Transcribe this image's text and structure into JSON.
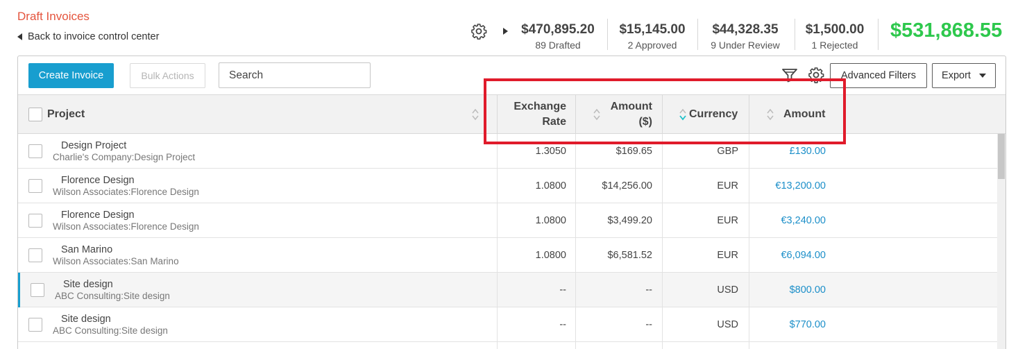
{
  "header": {
    "title": "Draft Invoices",
    "back_link": "Back to invoice control center"
  },
  "summary": {
    "stats": [
      {
        "amount": "$470,895.20",
        "label": "89 Drafted"
      },
      {
        "amount": "$15,145.00",
        "label": "2 Approved"
      },
      {
        "amount": "$44,328.35",
        "label": "9 Under Review"
      },
      {
        "amount": "$1,500.00",
        "label": "1 Rejected"
      }
    ],
    "total": "$531,868.55",
    "total_color": "#2ec84d"
  },
  "toolbar": {
    "create_label": "Create Invoice",
    "bulk_label": "Bulk Actions",
    "search_placeholder": "Search",
    "advanced_filters_label": "Advanced Filters",
    "export_label": "Export"
  },
  "table": {
    "headers": {
      "project": "Project",
      "exchange_rate_1": "Exchange",
      "exchange_rate_2": "Rate",
      "amount_usd_1": "Amount",
      "amount_usd_2": "($)",
      "currency": "Currency",
      "amount": "Amount"
    },
    "rows": [
      {
        "name": "Design Project",
        "client": "Charlie's Company:Design Project",
        "rate": "1.3050",
        "usd": "$169.65",
        "currency": "GBP",
        "amount": "£130.00",
        "highlighted": false
      },
      {
        "name": "Florence Design",
        "client": "Wilson Associates:Florence Design",
        "rate": "1.0800",
        "usd": "$14,256.00",
        "currency": "EUR",
        "amount": "€13,200.00",
        "highlighted": false
      },
      {
        "name": "Florence Design",
        "client": "Wilson Associates:Florence Design",
        "rate": "1.0800",
        "usd": "$3,499.20",
        "currency": "EUR",
        "amount": "€3,240.00",
        "highlighted": false
      },
      {
        "name": "San Marino",
        "client": "Wilson Associates:San Marino",
        "rate": "1.0800",
        "usd": "$6,581.52",
        "currency": "EUR",
        "amount": "€6,094.00",
        "highlighted": false
      },
      {
        "name": "Site design",
        "client": "ABC Consulting:Site design",
        "rate": "--",
        "usd": "--",
        "currency": "USD",
        "amount": "$800.00",
        "highlighted": true
      },
      {
        "name": "Site design",
        "client": "ABC Consulting:Site design",
        "rate": "--",
        "usd": "--",
        "currency": "USD",
        "amount": "$770.00",
        "highlighted": false
      }
    ]
  },
  "colors": {
    "title": "#e4543d",
    "primary": "#189ecf",
    "link": "#1c8fc9",
    "annotation": "#e01b2b"
  },
  "icons": [
    "gear-icon",
    "chevron-right-icon",
    "chevron-left-icon",
    "filter-icon",
    "chevron-down-icon",
    "sort-icon"
  ]
}
